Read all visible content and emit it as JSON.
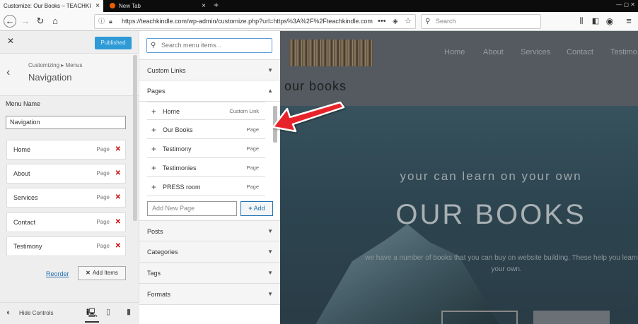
{
  "browser": {
    "tabs": [
      {
        "title": "Customize: Our Books – TEACHKI",
        "active": true
      },
      {
        "title": "New Tab",
        "active": false
      }
    ],
    "url": "https://teachkindle.com/wp-admin/customize.php?url=https%3A%2F%2Fteachkindle.com",
    "search_placeholder": "Search"
  },
  "customizer": {
    "close_label": "✕",
    "publish_label": "Published",
    "breadcrumb": "Customizing ▸ Menus",
    "section_title": "Navigation",
    "menu_name_label": "Menu Name",
    "menu_name_value": "Navigation",
    "menu_items": [
      {
        "label": "Home",
        "type": "Page"
      },
      {
        "label": "About",
        "type": "Page"
      },
      {
        "label": "Services",
        "type": "Page"
      },
      {
        "label": "Contact",
        "type": "Page"
      },
      {
        "label": "Testimony",
        "type": "Page"
      }
    ],
    "reorder_label": "Reorder",
    "add_items_label": "Add Items",
    "hide_controls_label": "Hide Controls"
  },
  "add_menu_items": {
    "search_placeholder": "Search menu items...",
    "sections": {
      "custom_links": "Custom Links",
      "pages": "Pages",
      "posts": "Posts",
      "categories": "Categories",
      "tags": "Tags",
      "formats": "Formats"
    },
    "pages": [
      {
        "label": "Home",
        "type": "Custom Link"
      },
      {
        "label": "Our Books",
        "type": "Page"
      },
      {
        "label": "Testimony",
        "type": "Page"
      },
      {
        "label": "Testimonies",
        "type": "Page"
      },
      {
        "label": "PRESS room",
        "type": "Page"
      }
    ],
    "new_page_placeholder": "Add New Page",
    "add_label": "Add"
  },
  "preview": {
    "nav": [
      "Home",
      "About",
      "Services",
      "Contact",
      "Testimo"
    ],
    "page_title": "our books",
    "tagline": "your can learn on your own",
    "headline": "OUR BOOKS",
    "description": "we have a number of books that you can buy on website building. These help you learn on your own."
  },
  "colors": {
    "accent": "#2e9ad6",
    "annotation_arrow": "#e8242b",
    "delete": "#cc0000"
  }
}
